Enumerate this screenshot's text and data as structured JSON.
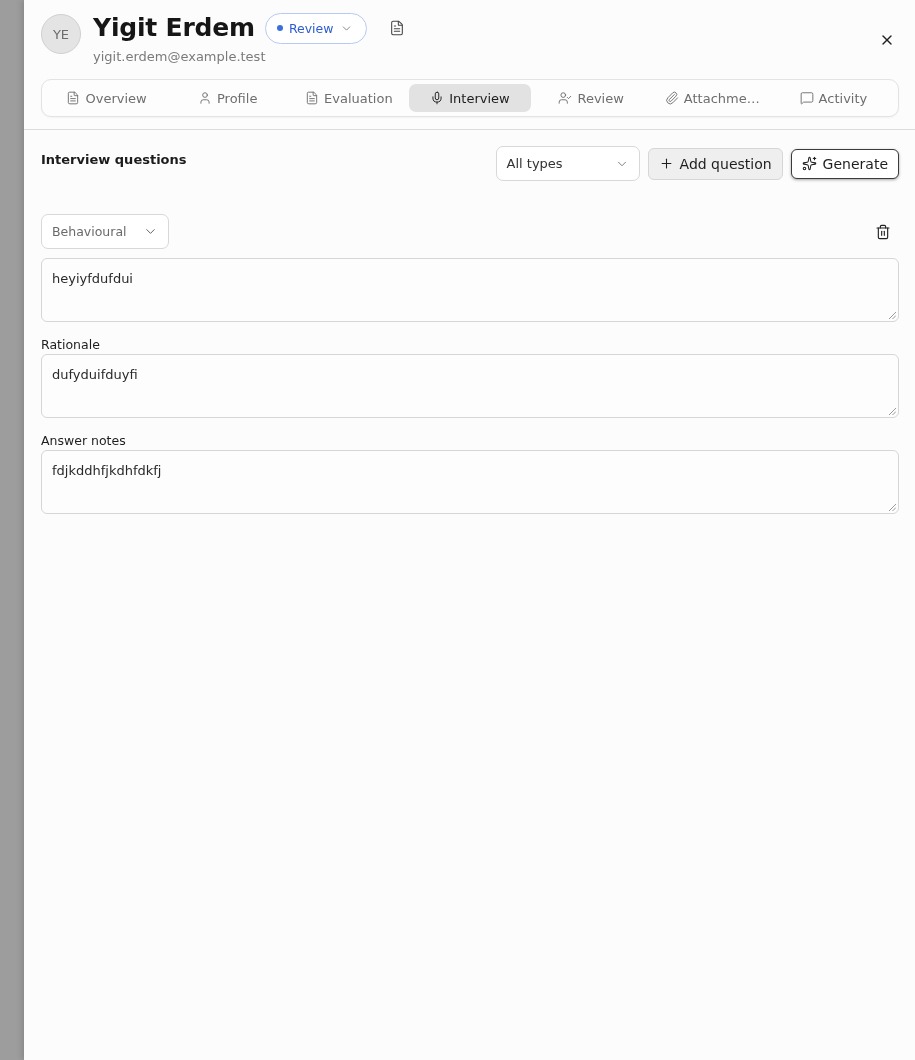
{
  "header": {
    "avatar": "YE",
    "name": "Yigit Erdem",
    "status": "Review",
    "email": "yigit.erdem@example.test"
  },
  "tabs": [
    {
      "label": "Overview",
      "selected": false
    },
    {
      "label": "Profile",
      "selected": false
    },
    {
      "label": "Evaluation",
      "selected": false
    },
    {
      "label": "Interview",
      "selected": true
    },
    {
      "label": "Review",
      "selected": false
    },
    {
      "label": "Attachme…",
      "selected": false
    },
    {
      "label": "Activity",
      "selected": false
    }
  ],
  "toolbar": {
    "title": "Interview questions",
    "type_filter": "All types",
    "buttons": [
      {
        "label": "Add question",
        "kind": "add"
      },
      {
        "label": "Generate",
        "kind": "generate"
      }
    ]
  },
  "questions": [
    {
      "type": "Behavioural",
      "question": "heyiyfdufdui",
      "fields": [
        {
          "label": "Rationale",
          "value": "dufyduifduyfi"
        },
        {
          "label": "Answer notes",
          "value": "fdjkddhfjkdhfdkfj"
        }
      ]
    }
  ]
}
